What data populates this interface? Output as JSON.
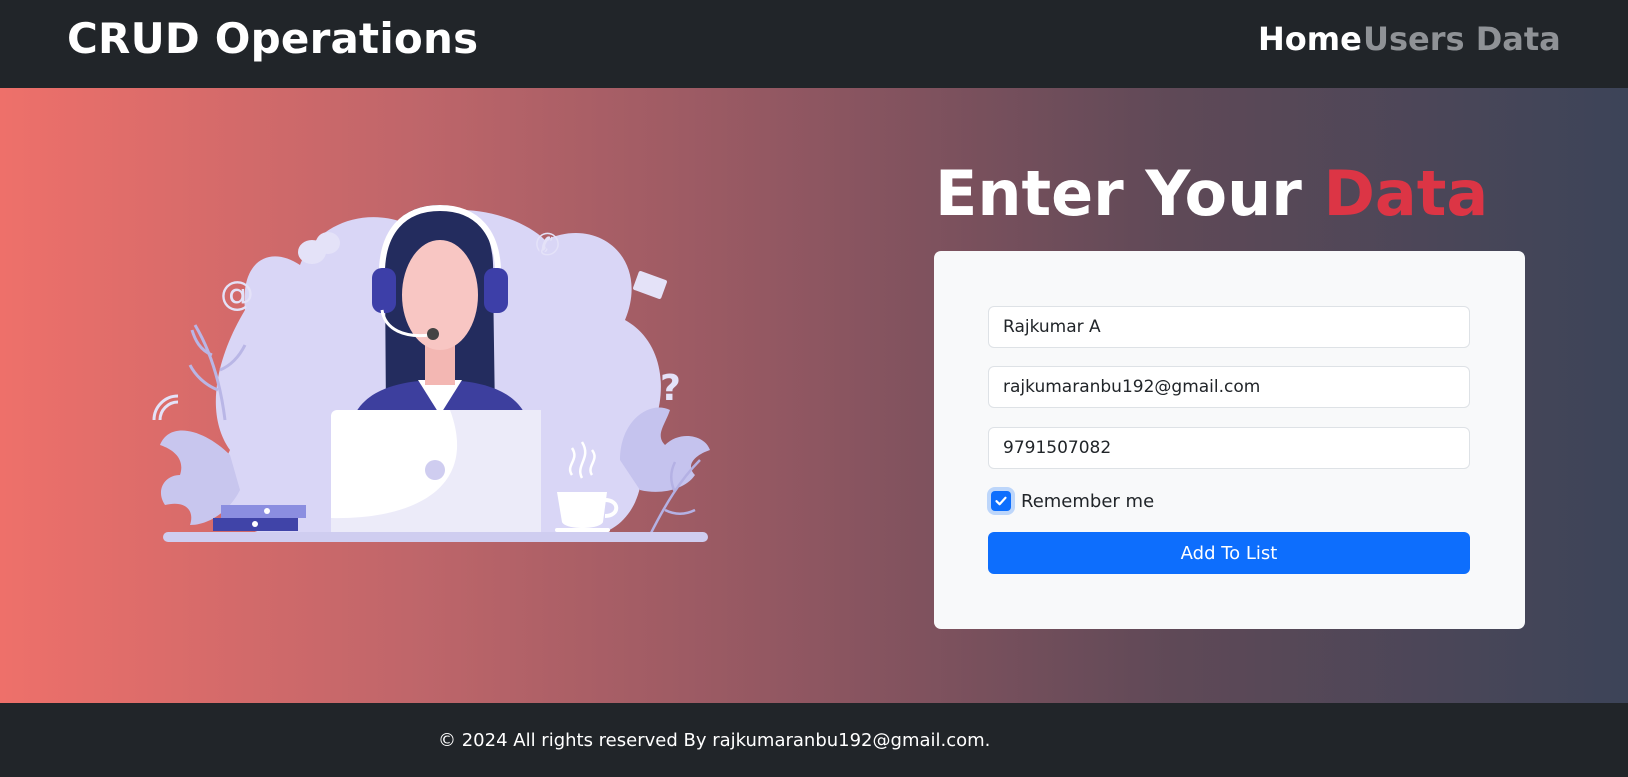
{
  "navbar": {
    "brand": "CRUD Operations",
    "links": [
      {
        "label": "Home",
        "active": true
      },
      {
        "label": "Users Data",
        "active": false
      }
    ]
  },
  "hero": {
    "heading_main": "Enter Your ",
    "heading_accent": "Data"
  },
  "form": {
    "name_value": "Rajkumar A",
    "email_value": "rajkumaranbu192@gmail.com",
    "phone_value": "9791507082",
    "remember_label": "Remember me",
    "remember_checked": true,
    "submit_label": "Add To List"
  },
  "footer": {
    "text": "© 2024 All rights reserved By rajkumaranbu192@gmail.com."
  },
  "colors": {
    "navbar_bg": "#212529",
    "accent_red": "#dc3545",
    "primary_blue": "#0d6efd",
    "card_bg": "#f8f9fa",
    "gradient_start": "#ee706a",
    "gradient_end": "#3c4458"
  },
  "icons": [
    "support-agent-illustration",
    "checkmark-icon"
  ]
}
